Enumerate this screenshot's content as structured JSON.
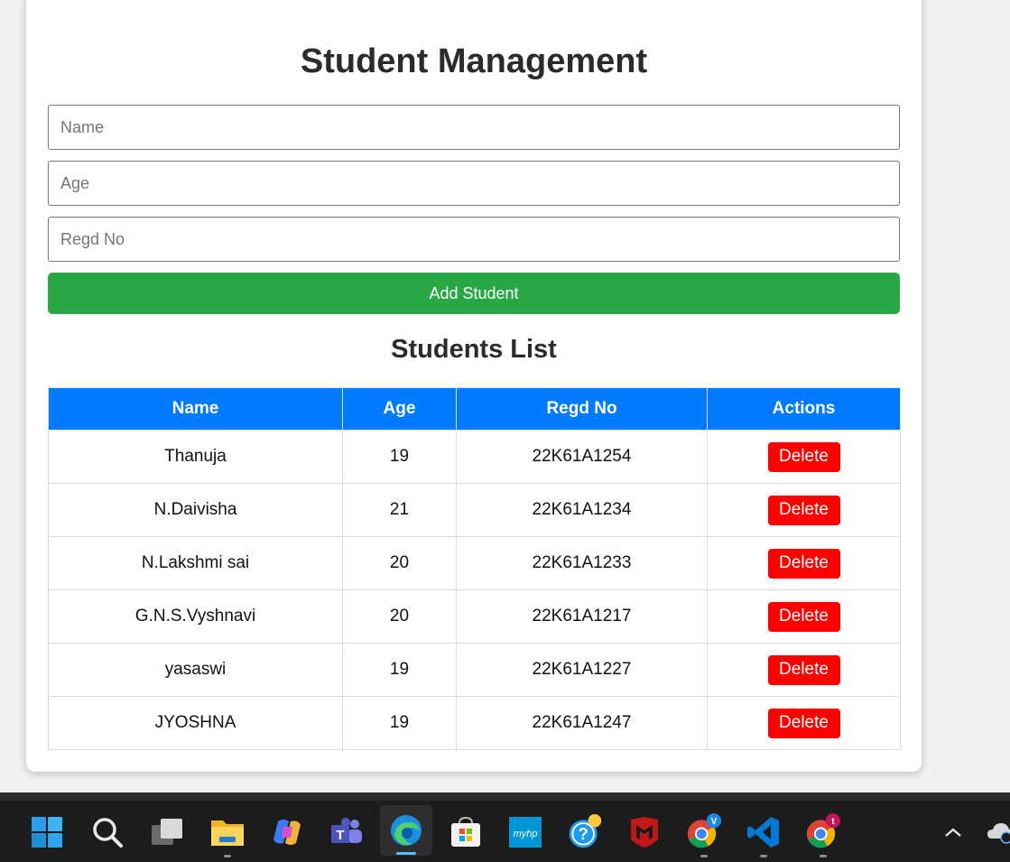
{
  "app": {
    "title": "Student Management",
    "form": {
      "name_placeholder": "Name",
      "age_placeholder": "Age",
      "regd_placeholder": "Regd No",
      "add_label": "Add Student"
    },
    "list_title": "Students List",
    "table": {
      "headers": [
        "Name",
        "Age",
        "Regd No",
        "Actions"
      ],
      "rows": [
        {
          "name": "Thanuja",
          "age": "19",
          "regd": "22K61A1254",
          "action": "Delete"
        },
        {
          "name": "N.Daivisha",
          "age": "21",
          "regd": "22K61A1234",
          "action": "Delete"
        },
        {
          "name": "N.Lakshmi sai",
          "age": "20",
          "regd": "22K61A1233",
          "action": "Delete"
        },
        {
          "name": "G.N.S.Vyshnavi",
          "age": "20",
          "regd": "22K61A1217",
          "action": "Delete"
        },
        {
          "name": "yasaswi",
          "age": "19",
          "regd": "22K61A1227",
          "action": "Delete"
        },
        {
          "name": "JYOSHNA",
          "age": "19",
          "regd": "22K61A1247",
          "action": "Delete"
        }
      ]
    }
  },
  "colors": {
    "add_button": "#28a745",
    "table_header": "#007bff",
    "delete_button": "#ff0000"
  },
  "taskbar": {
    "icons": [
      "windows-start-icon",
      "search-icon",
      "task-view-icon",
      "file-explorer-icon",
      "copilot-icon",
      "teams-icon",
      "edge-icon",
      "microsoft-store-icon",
      "myhp-icon",
      "help-icon",
      "mcafee-icon",
      "chrome-profile-v-icon",
      "vscode-icon",
      "chrome-profile-t-icon",
      "chevron-up-icon",
      "onedrive-icon"
    ],
    "myhp_text": "myhp",
    "chrome_v_badge": "V",
    "chrome_t_badge": "t"
  }
}
